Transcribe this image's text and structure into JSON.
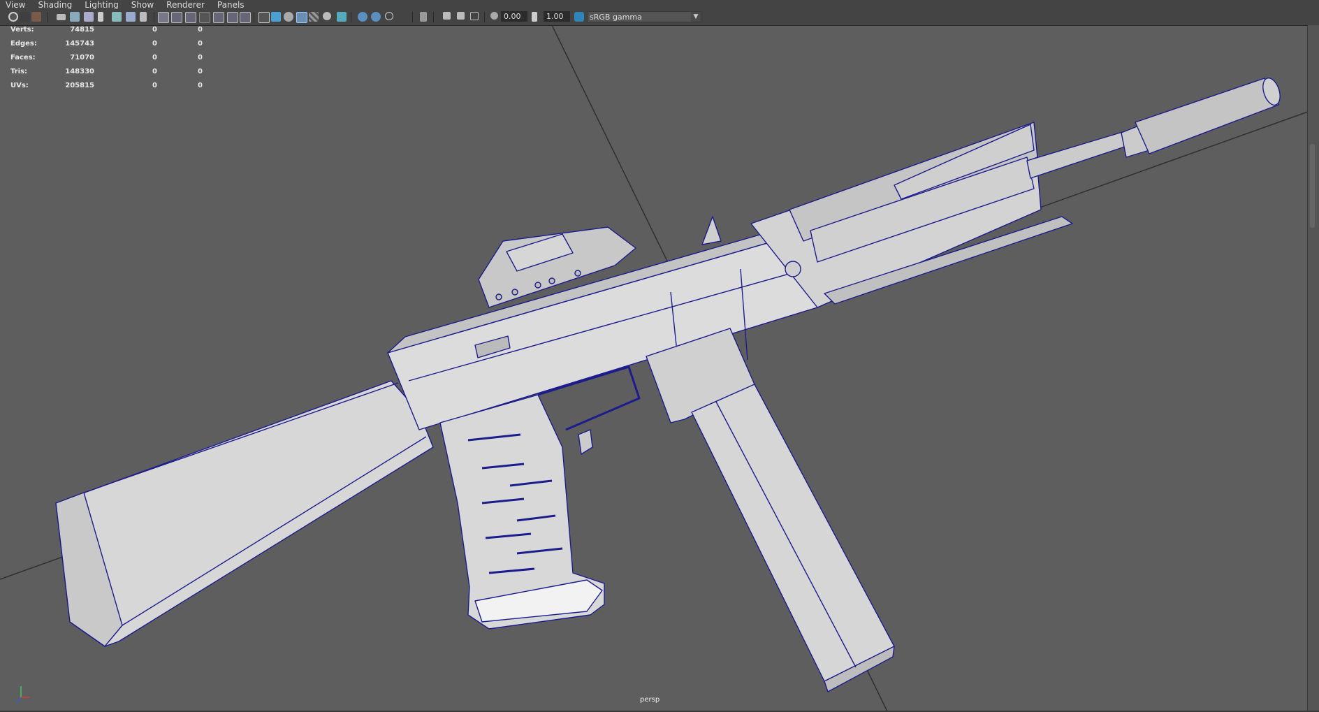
{
  "menu": [
    "View",
    "Shading",
    "Lighting",
    "Show",
    "Renderer",
    "Panels"
  ],
  "toolbar": {
    "exposure_value": "0.00",
    "gamma_value": "1.00",
    "color_space": "sRGB gamma",
    "icons": [
      "select-camera-icon",
      "camera-attributes-icon",
      "bookmarks-icon",
      "image-plane-icon",
      "grid-icon",
      "film-gate-icon",
      "resolution-gate-icon",
      "gate-mask-icon",
      "field-chart-icon",
      "safe-action-icon",
      "safe-title-icon",
      "wireframe-icon",
      "smooth-shade-icon",
      "default-material-icon",
      "textured-icon",
      "use-lights-icon",
      "shadows-icon",
      "ambient-occlusion-icon",
      "motion-blur-icon",
      "anti-aliasing-icon",
      "isolate-select-icon",
      "xray-icon",
      "xray-joints-icon",
      "exposure-icon",
      "gamma-icon",
      "color-management-icon"
    ]
  },
  "hud": {
    "rows": [
      {
        "label": "Verts:",
        "v1": "74815",
        "v2": "0",
        "v3": "0"
      },
      {
        "label": "Edges:",
        "v1": "145743",
        "v2": "0",
        "v3": "0"
      },
      {
        "label": "Faces:",
        "v1": "71070",
        "v2": "0",
        "v3": "0"
      },
      {
        "label": "Tris:",
        "v1": "148330",
        "v2": "0",
        "v3": "0"
      },
      {
        "label": "UVs:",
        "v1": "205815",
        "v2": "0",
        "v3": "0"
      }
    ]
  },
  "camera_name": "persp",
  "axis": {
    "x_color": "#d23c3c",
    "y_color": "#3ccc5a",
    "z_color": "#3c5adc"
  },
  "colors": {
    "model_fill": "#d6d6d6",
    "wire": "#1c1c8c",
    "viewport_bg": "#5e5e5e"
  }
}
